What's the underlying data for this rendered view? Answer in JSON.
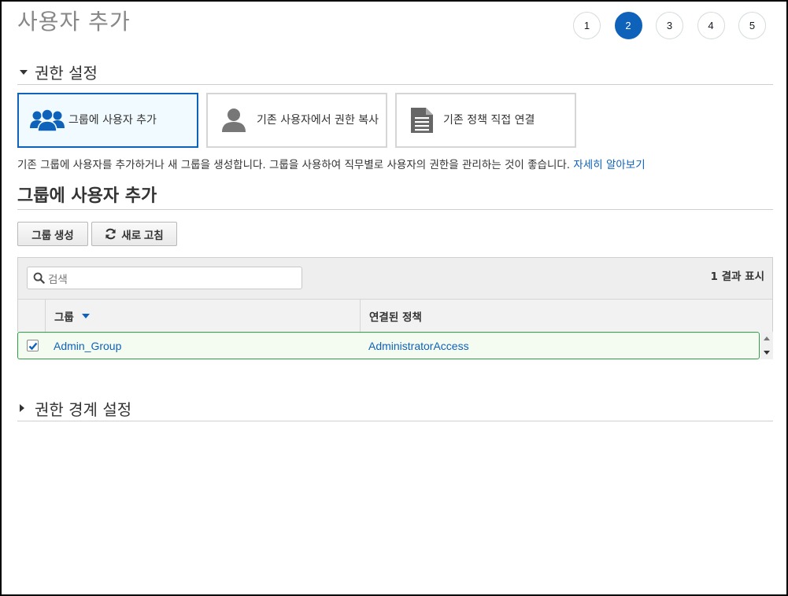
{
  "page": {
    "title": "사용자 추가"
  },
  "steps": [
    {
      "label": "1",
      "active": false
    },
    {
      "label": "2",
      "active": true
    },
    {
      "label": "3",
      "active": false
    },
    {
      "label": "4",
      "active": false
    },
    {
      "label": "5",
      "active": false
    }
  ],
  "permissions": {
    "section_title": "권한 설정",
    "options": [
      {
        "label": "그룹에 사용자 추가",
        "icon": "users-group-icon",
        "selected": true
      },
      {
        "label": "기존 사용자에서 권한 복사",
        "icon": "user-icon",
        "selected": false
      },
      {
        "label": "기존 정책 직접 연결",
        "icon": "document-icon",
        "selected": false
      }
    ],
    "description": "기존 그룹에 사용자를 추가하거나 새 그룹을 생성합니다. 그룹을 사용하여 직무별로 사용자의 권한을 관리하는 것이 좋습니다.",
    "learn_more": "자세히 알아보기"
  },
  "groups": {
    "title": "그룹에 사용자 추가",
    "create_button": "그룹 생성",
    "refresh_button": "새로 고침",
    "search_placeholder": "검색",
    "result_count": "1 결과 표시",
    "columns": {
      "group": "그룹",
      "policies": "연결된 정책"
    },
    "rows": [
      {
        "group": "Admin_Group",
        "policy": "AdministratorAccess",
        "checked": true
      }
    ]
  },
  "boundary": {
    "section_title": "권한 경계 설정"
  },
  "colors": {
    "accent": "#0f62ba",
    "selected_row_border": "#2ea043"
  }
}
